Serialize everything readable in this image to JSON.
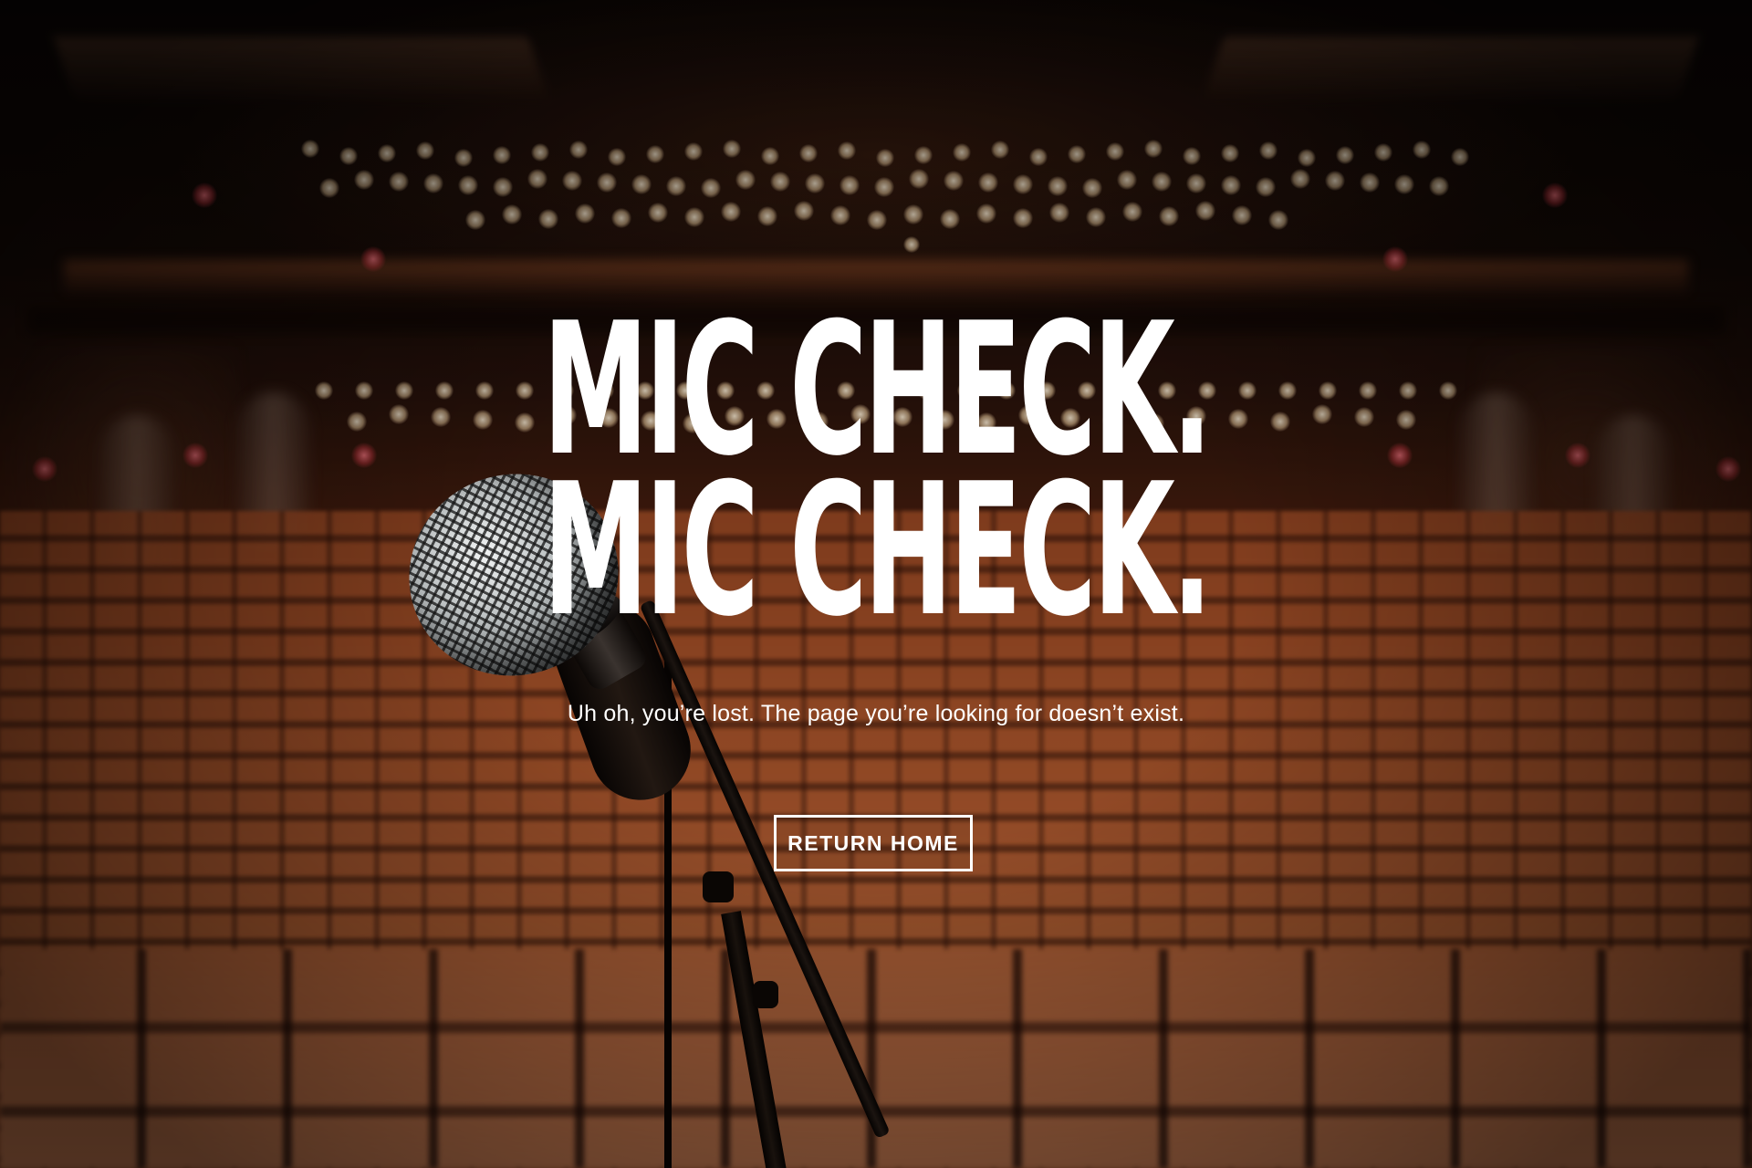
{
  "hero": {
    "headline_line1": "MIC CHECK.",
    "headline_line2": "MIC CHECK.",
    "message": "Uh oh, you’re lost. The page you’re looking for doesn’t exist."
  },
  "cta": {
    "label": "RETURN HOME"
  },
  "colors": {
    "text": "#ffffff",
    "seats": "#b45a2e",
    "background_dark": "#120805"
  }
}
